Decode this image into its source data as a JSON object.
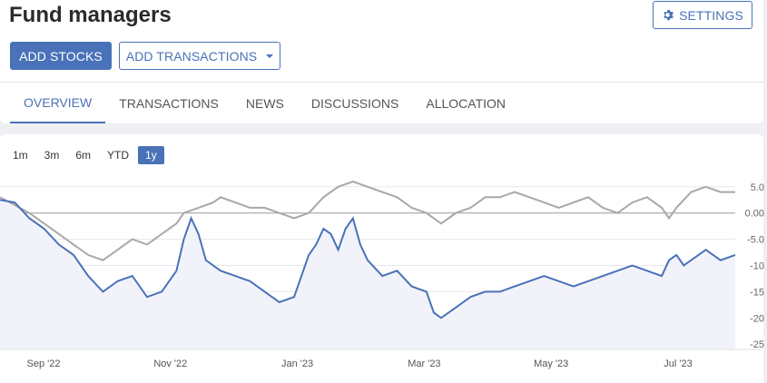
{
  "header": {
    "title": "Fund managers",
    "add_stocks_label": "ADD STOCKS",
    "add_transactions_label": "ADD TRANSACTIONS",
    "settings_label": "SETTINGS"
  },
  "tabs": [
    {
      "label": "OVERVIEW",
      "active": true
    },
    {
      "label": "TRANSACTIONS",
      "active": false
    },
    {
      "label": "NEWS",
      "active": false
    },
    {
      "label": "DISCUSSIONS",
      "active": false
    },
    {
      "label": "ALLOCATION",
      "active": false
    }
  ],
  "ranges": [
    {
      "label": "1m",
      "active": false
    },
    {
      "label": "3m",
      "active": false
    },
    {
      "label": "6m",
      "active": false
    },
    {
      "label": "YTD",
      "active": false
    },
    {
      "label": "1y",
      "active": true
    }
  ],
  "colors": {
    "accent": "#4a72b8",
    "benchmark": "#a8a8a8"
  },
  "chart_data": {
    "type": "line",
    "x_labels": [
      "Sep '22",
      "Nov '22",
      "Jan '23",
      "Mar '23",
      "May '23",
      "Jul '23"
    ],
    "y_ticks": [
      "5.0",
      "0.00",
      "-5.0",
      "-10",
      "-15",
      "-20",
      "-25"
    ],
    "y_tick_values": [
      5,
      0,
      -5,
      -10,
      -15,
      -20,
      -25
    ],
    "ylim": [
      -26,
      6
    ],
    "grid": true,
    "series": [
      {
        "role": "portfolio",
        "color": "#4a72b8",
        "points": [
          [
            0,
            2.5
          ],
          [
            0.02,
            2
          ],
          [
            0.04,
            -1
          ],
          [
            0.06,
            -3
          ],
          [
            0.08,
            -6
          ],
          [
            0.1,
            -8
          ],
          [
            0.12,
            -12
          ],
          [
            0.14,
            -15
          ],
          [
            0.16,
            -13
          ],
          [
            0.18,
            -12
          ],
          [
            0.2,
            -16
          ],
          [
            0.22,
            -15
          ],
          [
            0.24,
            -11
          ],
          [
            0.25,
            -5
          ],
          [
            0.26,
            -1
          ],
          [
            0.27,
            -4
          ],
          [
            0.28,
            -9
          ],
          [
            0.3,
            -11
          ],
          [
            0.32,
            -12
          ],
          [
            0.34,
            -13
          ],
          [
            0.36,
            -15
          ],
          [
            0.38,
            -17
          ],
          [
            0.4,
            -16
          ],
          [
            0.41,
            -12
          ],
          [
            0.42,
            -8
          ],
          [
            0.43,
            -6
          ],
          [
            0.44,
            -3
          ],
          [
            0.45,
            -4
          ],
          [
            0.46,
            -7
          ],
          [
            0.47,
            -3
          ],
          [
            0.48,
            -1
          ],
          [
            0.49,
            -6
          ],
          [
            0.5,
            -9
          ],
          [
            0.52,
            -12
          ],
          [
            0.54,
            -11
          ],
          [
            0.56,
            -14
          ],
          [
            0.58,
            -15
          ],
          [
            0.59,
            -19
          ],
          [
            0.6,
            -20
          ],
          [
            0.62,
            -18
          ],
          [
            0.64,
            -16
          ],
          [
            0.66,
            -15
          ],
          [
            0.68,
            -15
          ],
          [
            0.7,
            -14
          ],
          [
            0.72,
            -13
          ],
          [
            0.74,
            -12
          ],
          [
            0.76,
            -13
          ],
          [
            0.78,
            -14
          ],
          [
            0.8,
            -13
          ],
          [
            0.82,
            -12
          ],
          [
            0.84,
            -11
          ],
          [
            0.86,
            -10
          ],
          [
            0.88,
            -11
          ],
          [
            0.9,
            -12
          ],
          [
            0.91,
            -9
          ],
          [
            0.92,
            -8
          ],
          [
            0.93,
            -10
          ],
          [
            0.95,
            -8
          ],
          [
            0.96,
            -7
          ],
          [
            0.98,
            -9
          ],
          [
            1.0,
            -8
          ]
        ]
      },
      {
        "role": "benchmark",
        "color": "#a8a8a8",
        "points": [
          [
            0,
            3
          ],
          [
            0.02,
            1.5
          ],
          [
            0.04,
            0
          ],
          [
            0.06,
            -2
          ],
          [
            0.08,
            -4
          ],
          [
            0.1,
            -6
          ],
          [
            0.12,
            -8
          ],
          [
            0.14,
            -9
          ],
          [
            0.16,
            -7
          ],
          [
            0.18,
            -5
          ],
          [
            0.2,
            -6
          ],
          [
            0.22,
            -4
          ],
          [
            0.24,
            -2
          ],
          [
            0.25,
            0
          ],
          [
            0.27,
            1
          ],
          [
            0.29,
            2
          ],
          [
            0.3,
            3
          ],
          [
            0.32,
            2
          ],
          [
            0.34,
            1
          ],
          [
            0.36,
            1
          ],
          [
            0.38,
            0
          ],
          [
            0.4,
            -1
          ],
          [
            0.42,
            0
          ],
          [
            0.44,
            3
          ],
          [
            0.46,
            5
          ],
          [
            0.48,
            6
          ],
          [
            0.5,
            5
          ],
          [
            0.52,
            4
          ],
          [
            0.54,
            3
          ],
          [
            0.56,
            1
          ],
          [
            0.58,
            0
          ],
          [
            0.6,
            -2
          ],
          [
            0.61,
            -1
          ],
          [
            0.62,
            0
          ],
          [
            0.64,
            1
          ],
          [
            0.66,
            3
          ],
          [
            0.68,
            3
          ],
          [
            0.7,
            4
          ],
          [
            0.72,
            3
          ],
          [
            0.74,
            2
          ],
          [
            0.76,
            1
          ],
          [
            0.78,
            2
          ],
          [
            0.8,
            3
          ],
          [
            0.82,
            1
          ],
          [
            0.84,
            0
          ],
          [
            0.86,
            2
          ],
          [
            0.88,
            3
          ],
          [
            0.9,
            1
          ],
          [
            0.91,
            -1
          ],
          [
            0.92,
            1
          ],
          [
            0.94,
            4
          ],
          [
            0.96,
            5
          ],
          [
            0.98,
            4
          ],
          [
            1.0,
            4
          ]
        ]
      }
    ]
  }
}
